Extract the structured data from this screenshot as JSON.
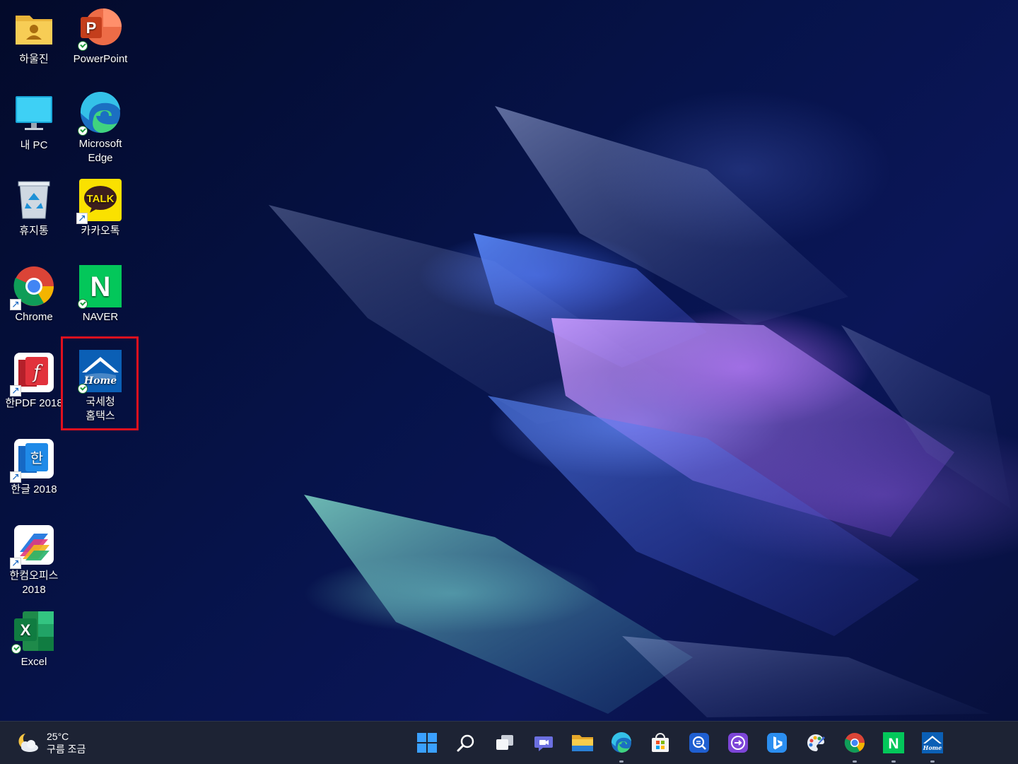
{
  "desktop": {
    "icons": [
      {
        "id": "user-folder",
        "label": "하울진"
      },
      {
        "id": "powerpoint",
        "label": "PowerPoint"
      },
      {
        "id": "my-pc",
        "label": "내 PC"
      },
      {
        "id": "edge",
        "label": "Microsoft Edge"
      },
      {
        "id": "recycle-bin",
        "label": "휴지통"
      },
      {
        "id": "kakaotalk",
        "label": "카카오톡",
        "glyph_text": "TALK"
      },
      {
        "id": "chrome",
        "label": "Chrome"
      },
      {
        "id": "naver",
        "label": "NAVER",
        "glyph_text": "N"
      },
      {
        "id": "hanpdf",
        "label": "한PDF 2018"
      },
      {
        "id": "hometax",
        "label": "국세청 홈택스",
        "glyph_text": "Home"
      },
      {
        "id": "hangul",
        "label": "한글 2018",
        "glyph_text": "한"
      },
      {
        "id": "hancom-office",
        "label": "한컴오피스 2018"
      },
      {
        "id": "excel",
        "label": "Excel",
        "glyph_text": "X"
      }
    ],
    "highlighted_icon": "hometax",
    "highlight_color": "#e0101e"
  },
  "taskbar": {
    "weather": {
      "temperature": "25°C",
      "condition": "구름 조금",
      "icon": "partly-cloudy-night-icon"
    },
    "apps": [
      {
        "name": "start-button",
        "icon": "windows-logo-icon"
      },
      {
        "name": "search-button",
        "icon": "search-icon"
      },
      {
        "name": "task-view-button",
        "icon": "task-view-icon"
      },
      {
        "name": "chat-button",
        "icon": "teams-chat-icon"
      },
      {
        "name": "file-explorer",
        "icon": "folder-icon"
      },
      {
        "name": "edge",
        "icon": "edge-icon",
        "running": true
      },
      {
        "name": "microsoft-store",
        "icon": "store-icon"
      },
      {
        "name": "app-blue-search",
        "icon": "blue-search-app-icon"
      },
      {
        "name": "app-purple-arrow",
        "icon": "purple-arrow-app-icon"
      },
      {
        "name": "bing",
        "icon": "bing-icon"
      },
      {
        "name": "paint",
        "icon": "paint-palette-icon"
      },
      {
        "name": "chrome",
        "icon": "chrome-icon",
        "running": true
      },
      {
        "name": "naver",
        "icon": "naver-icon",
        "running": true
      },
      {
        "name": "hometax",
        "icon": "hometax-icon",
        "running": true
      }
    ],
    "background": "#1d2334"
  }
}
